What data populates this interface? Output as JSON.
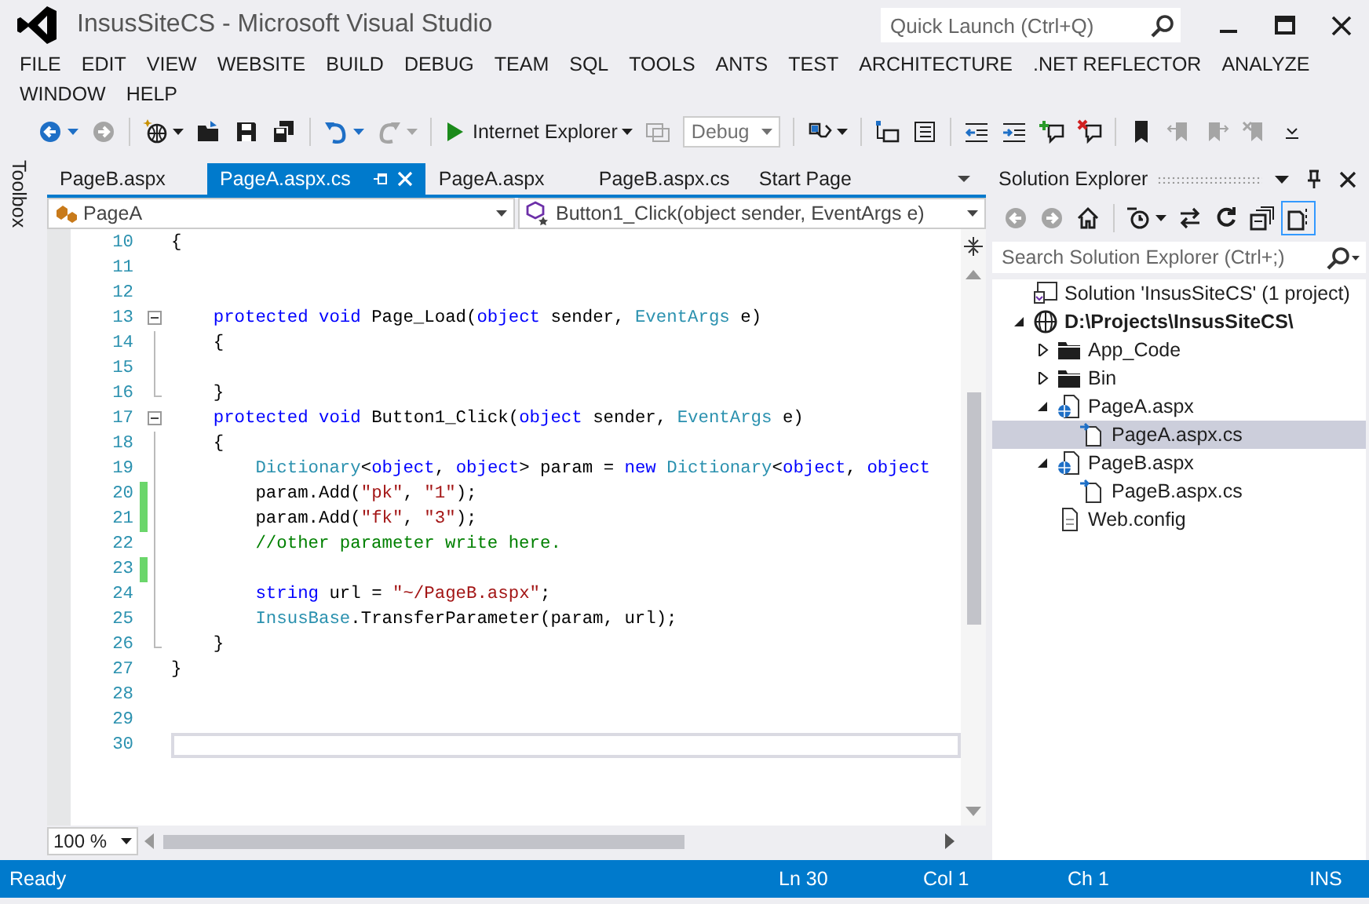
{
  "window": {
    "title": "InsusSiteCS - Microsoft Visual Studio",
    "quick_launch": {
      "placeholder": "Quick Launch (Ctrl+Q)"
    }
  },
  "menu": [
    "FILE",
    "EDIT",
    "VIEW",
    "WEBSITE",
    "BUILD",
    "DEBUG",
    "TEAM",
    "SQL",
    "TOOLS",
    "ANTS",
    "TEST",
    "ARCHITECTURE",
    ".NET REFLECTOR",
    "ANALYZE",
    "WINDOW",
    "HELP"
  ],
  "toolbar": [
    {
      "kind": "back",
      "disabled": false,
      "menu": true
    },
    {
      "kind": "forward",
      "disabled": true,
      "menu": false
    },
    {
      "kind": "separator"
    },
    {
      "kind": "new-project",
      "disabled": false,
      "menu": true
    },
    {
      "kind": "open",
      "disabled": false,
      "menu": false
    },
    {
      "kind": "save",
      "disabled": false,
      "menu": false
    },
    {
      "kind": "save-all",
      "disabled": false,
      "menu": false
    },
    {
      "kind": "separator"
    },
    {
      "kind": "undo",
      "disabled": false,
      "menu": true
    },
    {
      "kind": "redo",
      "disabled": true,
      "menu": true
    },
    {
      "kind": "separator"
    },
    {
      "kind": "run",
      "label": "Internet Explorer",
      "disabled": false,
      "menu": true
    },
    {
      "kind": "attach",
      "disabled": true,
      "menu": false
    },
    {
      "kind": "combo",
      "value": "Debug"
    },
    {
      "kind": "separator"
    },
    {
      "kind": "find",
      "disabled": false,
      "menu": true
    },
    {
      "kind": "separator"
    },
    {
      "kind": "members",
      "disabled": false,
      "menu": false
    },
    {
      "kind": "params",
      "disabled": false,
      "menu": false
    },
    {
      "kind": "separator"
    },
    {
      "kind": "outdent",
      "disabled": false,
      "menu": false
    },
    {
      "kind": "indent",
      "disabled": false,
      "menu": false
    },
    {
      "kind": "comment",
      "disabled": false,
      "menu": false
    },
    {
      "kind": "uncomment",
      "disabled": false,
      "menu": false
    },
    {
      "kind": "separator"
    },
    {
      "kind": "bookmark",
      "disabled": false,
      "menu": false
    },
    {
      "kind": "prev-bookmark",
      "disabled": true,
      "menu": false
    },
    {
      "kind": "next-bookmark",
      "disabled": true,
      "menu": false
    },
    {
      "kind": "clear-bookmark",
      "disabled": true,
      "menu": false
    },
    {
      "kind": "overflow",
      "disabled": false,
      "menu": false
    }
  ],
  "toolbox": {
    "label": "Toolbox"
  },
  "tabs": [
    {
      "label": "PageB.aspx",
      "selected": false
    },
    {
      "label": "PageA.aspx.cs",
      "selected": true
    },
    {
      "label": "PageA.aspx",
      "selected": false
    },
    {
      "label": "PageB.aspx.cs",
      "selected": false
    },
    {
      "label": "Start Page",
      "selected": false
    }
  ],
  "navigation": {
    "type": "PageA",
    "member": "Button1_Click(object sender, EventArgs e)"
  },
  "code_lines": [
    {
      "number": "10",
      "fold_box": false,
      "fold_line": false,
      "fold_end": false,
      "changed": false,
      "current": false,
      "tokens": [
        {
          "kind": "plain",
          "text": "{"
        }
      ]
    },
    {
      "number": "11",
      "fold_box": false,
      "fold_line": false,
      "fold_end": false,
      "changed": false,
      "current": false
    },
    {
      "number": "12",
      "fold_box": false,
      "fold_line": false,
      "fold_end": false,
      "changed": false,
      "current": false
    },
    {
      "number": "13",
      "fold_box": true,
      "fold_line": false,
      "fold_end": false,
      "changed": false,
      "current": false,
      "tokens": [
        {
          "kind": "keyword",
          "text": "    protected"
        },
        {
          "kind": "keyword",
          "text": " void"
        },
        {
          "kind": "plain",
          "text": " Page_Load("
        },
        {
          "kind": "keyword",
          "text": "object"
        },
        {
          "kind": "plain",
          "text": " sender, "
        },
        {
          "kind": "type",
          "text": "EventArgs"
        },
        {
          "kind": "plain",
          "text": " e)"
        }
      ]
    },
    {
      "number": "14",
      "fold_box": false,
      "fold_line": true,
      "fold_end": false,
      "changed": false,
      "current": false,
      "tokens": [
        {
          "kind": "plain",
          "text": "    {"
        }
      ]
    },
    {
      "number": "15",
      "fold_box": false,
      "fold_line": true,
      "fold_end": false,
      "changed": false,
      "current": false
    },
    {
      "number": "16",
      "fold_box": false,
      "fold_line": false,
      "fold_end": true,
      "changed": false,
      "current": false,
      "tokens": [
        {
          "kind": "plain",
          "text": "    }"
        }
      ]
    },
    {
      "number": "17",
      "fold_box": true,
      "fold_line": false,
      "fold_end": false,
      "changed": false,
      "current": false,
      "tokens": [
        {
          "kind": "keyword",
          "text": "    protected"
        },
        {
          "kind": "keyword",
          "text": " void"
        },
        {
          "kind": "plain",
          "text": " Button1_Click("
        },
        {
          "kind": "keyword",
          "text": "object"
        },
        {
          "kind": "plain",
          "text": " sender, "
        },
        {
          "kind": "type",
          "text": "EventArgs"
        },
        {
          "kind": "plain",
          "text": " e)"
        }
      ]
    },
    {
      "number": "18",
      "fold_box": false,
      "fold_line": true,
      "fold_end": false,
      "changed": false,
      "current": false,
      "tokens": [
        {
          "kind": "plain",
          "text": "    {"
        }
      ]
    },
    {
      "number": "19",
      "fold_box": false,
      "fold_line": true,
      "fold_end": false,
      "changed": false,
      "current": false,
      "tokens": [
        {
          "kind": "type",
          "text": "        Dictionary"
        },
        {
          "kind": "plain",
          "text": "<"
        },
        {
          "kind": "keyword",
          "text": "object"
        },
        {
          "kind": "plain",
          "text": ", "
        },
        {
          "kind": "keyword",
          "text": "object"
        },
        {
          "kind": "plain",
          "text": "> param = "
        },
        {
          "kind": "keyword",
          "text": "new"
        },
        {
          "kind": "type",
          "text": " Dictionary"
        },
        {
          "kind": "plain",
          "text": "<"
        },
        {
          "kind": "keyword",
          "text": "object"
        },
        {
          "kind": "plain",
          "text": ", "
        },
        {
          "kind": "keyword",
          "text": "object"
        }
      ]
    },
    {
      "number": "20",
      "fold_box": false,
      "fold_line": true,
      "fold_end": false,
      "changed": true,
      "current": false,
      "tokens": [
        {
          "kind": "plain",
          "text": "        param.Add("
        },
        {
          "kind": "string",
          "text": "\"pk\""
        },
        {
          "kind": "plain",
          "text": ", "
        },
        {
          "kind": "string",
          "text": "\"1\""
        },
        {
          "kind": "plain",
          "text": ");"
        }
      ]
    },
    {
      "number": "21",
      "fold_box": false,
      "fold_line": true,
      "fold_end": false,
      "changed": true,
      "current": false,
      "tokens": [
        {
          "kind": "plain",
          "text": "        param.Add("
        },
        {
          "kind": "string",
          "text": "\"fk\""
        },
        {
          "kind": "plain",
          "text": ", "
        },
        {
          "kind": "string",
          "text": "\"3\""
        },
        {
          "kind": "plain",
          "text": ");"
        }
      ]
    },
    {
      "number": "22",
      "fold_box": false,
      "fold_line": true,
      "fold_end": false,
      "changed": false,
      "current": false,
      "tokens": [
        {
          "kind": "comment",
          "text": "        //other parameter write here."
        }
      ]
    },
    {
      "number": "23",
      "fold_box": false,
      "fold_line": true,
      "fold_end": false,
      "changed": true,
      "current": false
    },
    {
      "number": "24",
      "fold_box": false,
      "fold_line": true,
      "fold_end": false,
      "changed": false,
      "current": false,
      "tokens": [
        {
          "kind": "keyword",
          "text": "        string"
        },
        {
          "kind": "plain",
          "text": " url = "
        },
        {
          "kind": "string",
          "text": "\"~/PageB.aspx\""
        },
        {
          "kind": "plain",
          "text": ";"
        }
      ]
    },
    {
      "number": "25",
      "fold_box": false,
      "fold_line": true,
      "fold_end": false,
      "changed": false,
      "current": false,
      "tokens": [
        {
          "kind": "type",
          "text": "        InsusBase"
        },
        {
          "kind": "plain",
          "text": ".TransferParameter(param, url);"
        }
      ]
    },
    {
      "number": "26",
      "fold_box": false,
      "fold_line": false,
      "fold_end": true,
      "changed": false,
      "current": false,
      "tokens": [
        {
          "kind": "plain",
          "text": "    }"
        }
      ]
    },
    {
      "number": "27",
      "fold_box": false,
      "fold_line": false,
      "fold_end": false,
      "changed": false,
      "current": false,
      "tokens": [
        {
          "kind": "plain",
          "text": "}"
        }
      ]
    },
    {
      "number": "28",
      "fold_box": false,
      "fold_line": false,
      "fold_end": false,
      "changed": false,
      "current": false
    },
    {
      "number": "29",
      "fold_box": false,
      "fold_line": false,
      "fold_end": false,
      "changed": false,
      "current": false
    },
    {
      "number": "30",
      "fold_box": false,
      "fold_line": false,
      "fold_end": false,
      "changed": false,
      "current": true
    }
  ],
  "zoom": {
    "value": "100 %"
  },
  "solution_explorer": {
    "title": "Solution Explorer",
    "toolbar": [
      {
        "kind": "back",
        "disabled": true
      },
      {
        "kind": "forward",
        "disabled": true
      },
      {
        "kind": "home",
        "disabled": false
      },
      {
        "kind": "separator"
      },
      {
        "kind": "history",
        "disabled": false,
        "menu": true
      },
      {
        "kind": "sync",
        "disabled": false
      },
      {
        "kind": "refresh",
        "disabled": false
      },
      {
        "kind": "collapse",
        "disabled": false
      },
      {
        "kind": "show-all",
        "disabled": false,
        "selected": true
      }
    ],
    "search": {
      "placeholder": "Search Solution Explorer (Ctrl+;)"
    },
    "tree": [
      {
        "label": "Solution 'InsusSiteCS' (1 project)",
        "kind": "solution",
        "selected": false,
        "children": [
          {
            "label": "D:\\Projects\\InsusSiteCS\\",
            "kind": "project",
            "expanded": true,
            "selected": false,
            "children": [
              {
                "label": "App_Code",
                "kind": "folder",
                "expanded": false,
                "selected": false
              },
              {
                "label": "Bin",
                "kind": "folder",
                "expanded": false,
                "selected": false
              },
              {
                "label": "PageA.aspx",
                "kind": "page",
                "expanded": true,
                "selected": false,
                "children": [
                  {
                    "label": "PageA.aspx.cs",
                    "kind": "code",
                    "selected": true
                  }
                ]
              },
              {
                "label": "PageB.aspx",
                "kind": "page",
                "expanded": true,
                "selected": false,
                "children": [
                  {
                    "label": "PageB.aspx.cs",
                    "kind": "code",
                    "selected": false
                  }
                ]
              },
              {
                "label": "Web.config",
                "kind": "config",
                "selected": false
              }
            ]
          }
        ]
      }
    ]
  },
  "status_bar": {
    "message": "Ready",
    "line": "Ln 30",
    "column": "Col 1",
    "char": "Ch 1",
    "mode": "INS"
  }
}
